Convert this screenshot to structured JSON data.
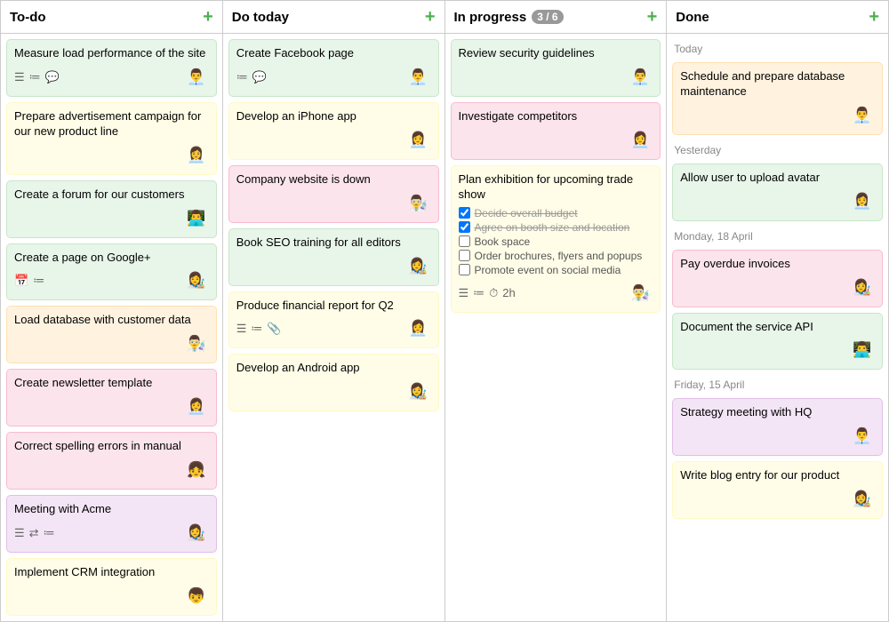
{
  "columns": [
    {
      "id": "todo",
      "title": "To-do",
      "badge": null,
      "add_label": "+",
      "cards": [
        {
          "id": "t1",
          "title": "Measure load performance of the site",
          "color": "card-green",
          "icons": [
            "☰",
            "≔",
            "💬"
          ],
          "avatar": "👨‍💼"
        },
        {
          "id": "t2",
          "title": "Prepare advertisement campaign for our new product line",
          "color": "card-yellow",
          "icons": [],
          "avatar": "👩‍💼"
        },
        {
          "id": "t3",
          "title": "Create a forum for our customers",
          "color": "card-green",
          "icons": [],
          "avatar": "👨‍💻"
        },
        {
          "id": "t4",
          "title": "Create a page on Google+",
          "color": "card-green",
          "icons": [
            "📅",
            "≔"
          ],
          "avatar": "👩‍🎨"
        },
        {
          "id": "t5",
          "title": "Load database with customer data",
          "color": "card-orange",
          "icons": [],
          "avatar": "👨‍🔬"
        },
        {
          "id": "t6",
          "title": "Create newsletter template",
          "color": "card-pink",
          "icons": [],
          "avatar": "👩‍💼"
        },
        {
          "id": "t7",
          "title": "Correct spelling errors in manual",
          "color": "card-pink",
          "icons": [],
          "avatar": "👧"
        },
        {
          "id": "t8",
          "title": "Meeting with Acme",
          "color": "card-purple",
          "icons": [
            "☰",
            "⇄",
            "≔"
          ],
          "avatar": "👩‍🎨"
        },
        {
          "id": "t9",
          "title": "Implement CRM integration",
          "color": "card-yellow",
          "icons": [],
          "avatar": "👦"
        }
      ]
    },
    {
      "id": "dotoday",
      "title": "Do today",
      "badge": null,
      "add_label": "+",
      "cards": [
        {
          "id": "d1",
          "title": "Create Facebook page",
          "color": "card-green",
          "icons": [
            "≔",
            "💬"
          ],
          "avatar": "👨‍💼"
        },
        {
          "id": "d2",
          "title": "Develop an iPhone app",
          "color": "card-yellow",
          "icons": [],
          "avatar": "👩‍💼"
        },
        {
          "id": "d3",
          "title": "Company website is down",
          "color": "card-pink",
          "icons": [],
          "avatar": "👨‍🔬"
        },
        {
          "id": "d4",
          "title": "Book SEO training for all editors",
          "color": "card-green",
          "icons": [],
          "avatar": "👩‍🎨"
        },
        {
          "id": "d5",
          "title": "Produce financial report for Q2",
          "color": "card-yellow",
          "icons": [
            "☰",
            "≔",
            "📎"
          ],
          "avatar": "👩‍💼"
        },
        {
          "id": "d6",
          "title": "Develop an Android app",
          "color": "card-yellow",
          "icons": [],
          "avatar": "👩‍🎨"
        }
      ]
    },
    {
      "id": "inprogress",
      "title": "In progress",
      "badge": "3 / 6",
      "add_label": "+",
      "cards": [
        {
          "id": "p1",
          "title": "Review security guidelines",
          "color": "card-green",
          "icons": [],
          "avatar": "👨‍💼"
        },
        {
          "id": "p2",
          "title": "Investigate competitors",
          "color": "card-pink",
          "icons": [],
          "avatar": "👩‍💼"
        },
        {
          "id": "p3",
          "title": "Plan exhibition for upcoming trade show",
          "color": "card-yellow",
          "icons": [
            "☰",
            "≔",
            "⏱",
            "2h"
          ],
          "avatar": "👨‍🔬",
          "checklist": [
            {
              "text": "Decide overall budget",
              "done": true
            },
            {
              "text": "Agree on booth size and location",
              "done": true
            },
            {
              "text": "Book space",
              "done": false
            },
            {
              "text": "Order brochures, flyers and popups",
              "done": false
            },
            {
              "text": "Promote event on social media",
              "done": false
            }
          ]
        }
      ]
    },
    {
      "id": "done",
      "title": "Done",
      "badge": null,
      "add_label": "+",
      "sections": [
        {
          "label": "Today",
          "cards": [
            {
              "id": "dn1",
              "title": "Schedule and prepare database maintenance",
              "color": "card-orange",
              "icons": [],
              "avatar": "👨‍💼"
            }
          ]
        },
        {
          "label": "Yesterday",
          "cards": [
            {
              "id": "dn2",
              "title": "Allow user to upload avatar",
              "color": "card-green",
              "icons": [],
              "avatar": "👩‍💼"
            }
          ]
        },
        {
          "label": "Monday, 18 April",
          "cards": [
            {
              "id": "dn3",
              "title": "Pay overdue invoices",
              "color": "card-pink",
              "icons": [],
              "avatar": "👩‍🎨"
            },
            {
              "id": "dn4",
              "title": "Document the service API",
              "color": "card-green",
              "icons": [],
              "avatar": "👨‍💻"
            }
          ]
        },
        {
          "label": "Friday, 15 April",
          "cards": [
            {
              "id": "dn5",
              "title": "Strategy meeting with HQ",
              "color": "card-purple",
              "icons": [],
              "avatar": "👨‍💼"
            },
            {
              "id": "dn6",
              "title": "Write blog entry for our product",
              "color": "card-yellow",
              "icons": [],
              "avatar": "👩‍🎨"
            }
          ]
        }
      ]
    }
  ]
}
